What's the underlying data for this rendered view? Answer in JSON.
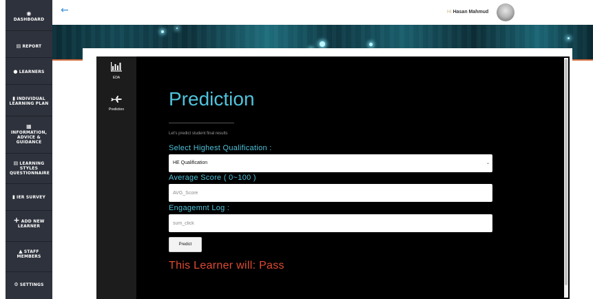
{
  "sidebar": {
    "items": [
      {
        "label": "DASHBOARD",
        "icon": "dashboard-icon"
      },
      {
        "label": "REPORT",
        "icon": "report-icon"
      },
      {
        "label": "LEARNERS",
        "icon": "learners-icon"
      },
      {
        "label": "INDIVIDUAL LEARNING PLAN",
        "icon": "plan-icon"
      },
      {
        "label": "INFORMATION, ADVICE & GUIDANCE",
        "icon": "info-icon"
      },
      {
        "label": "LEARNING STYLES QUESTIONNAIRE",
        "icon": "questionnaire-icon"
      },
      {
        "label": "IER SURVEY",
        "icon": "survey-icon"
      },
      {
        "label": "ADD NEW LEARNER",
        "icon": "plus-icon"
      },
      {
        "label": "STAFF MEMBERS",
        "icon": "staff-icon"
      },
      {
        "label": "SETTINGS",
        "icon": "gear-icon"
      }
    ]
  },
  "header": {
    "greeting": "Hi",
    "username": "Hasan Mahmud"
  },
  "subnav": {
    "items": [
      {
        "label": "EDA",
        "icon": "bar-chart-icon"
      },
      {
        "label": "Prediction",
        "icon": "airplane-icon"
      }
    ]
  },
  "main": {
    "title": "Prediction",
    "tagline": "Let's predict student final results",
    "qualification": {
      "label": "Select Highest Qualification :",
      "value": "HE Qualification"
    },
    "average_score": {
      "label": "Average Score ( 0~100 )",
      "placeholder": "AVG_Score"
    },
    "engagement": {
      "label": "Engagemnt Log :",
      "placeholder": "sum_click"
    },
    "predict_label": "Predict",
    "result": "This Learner will: Pass"
  },
  "colors": {
    "sidebar_bg": "#2e323c",
    "accent_cyan": "#4fc3dc",
    "result_red": "#e04a34",
    "back_arrow_blue": "#3a8fd6"
  }
}
